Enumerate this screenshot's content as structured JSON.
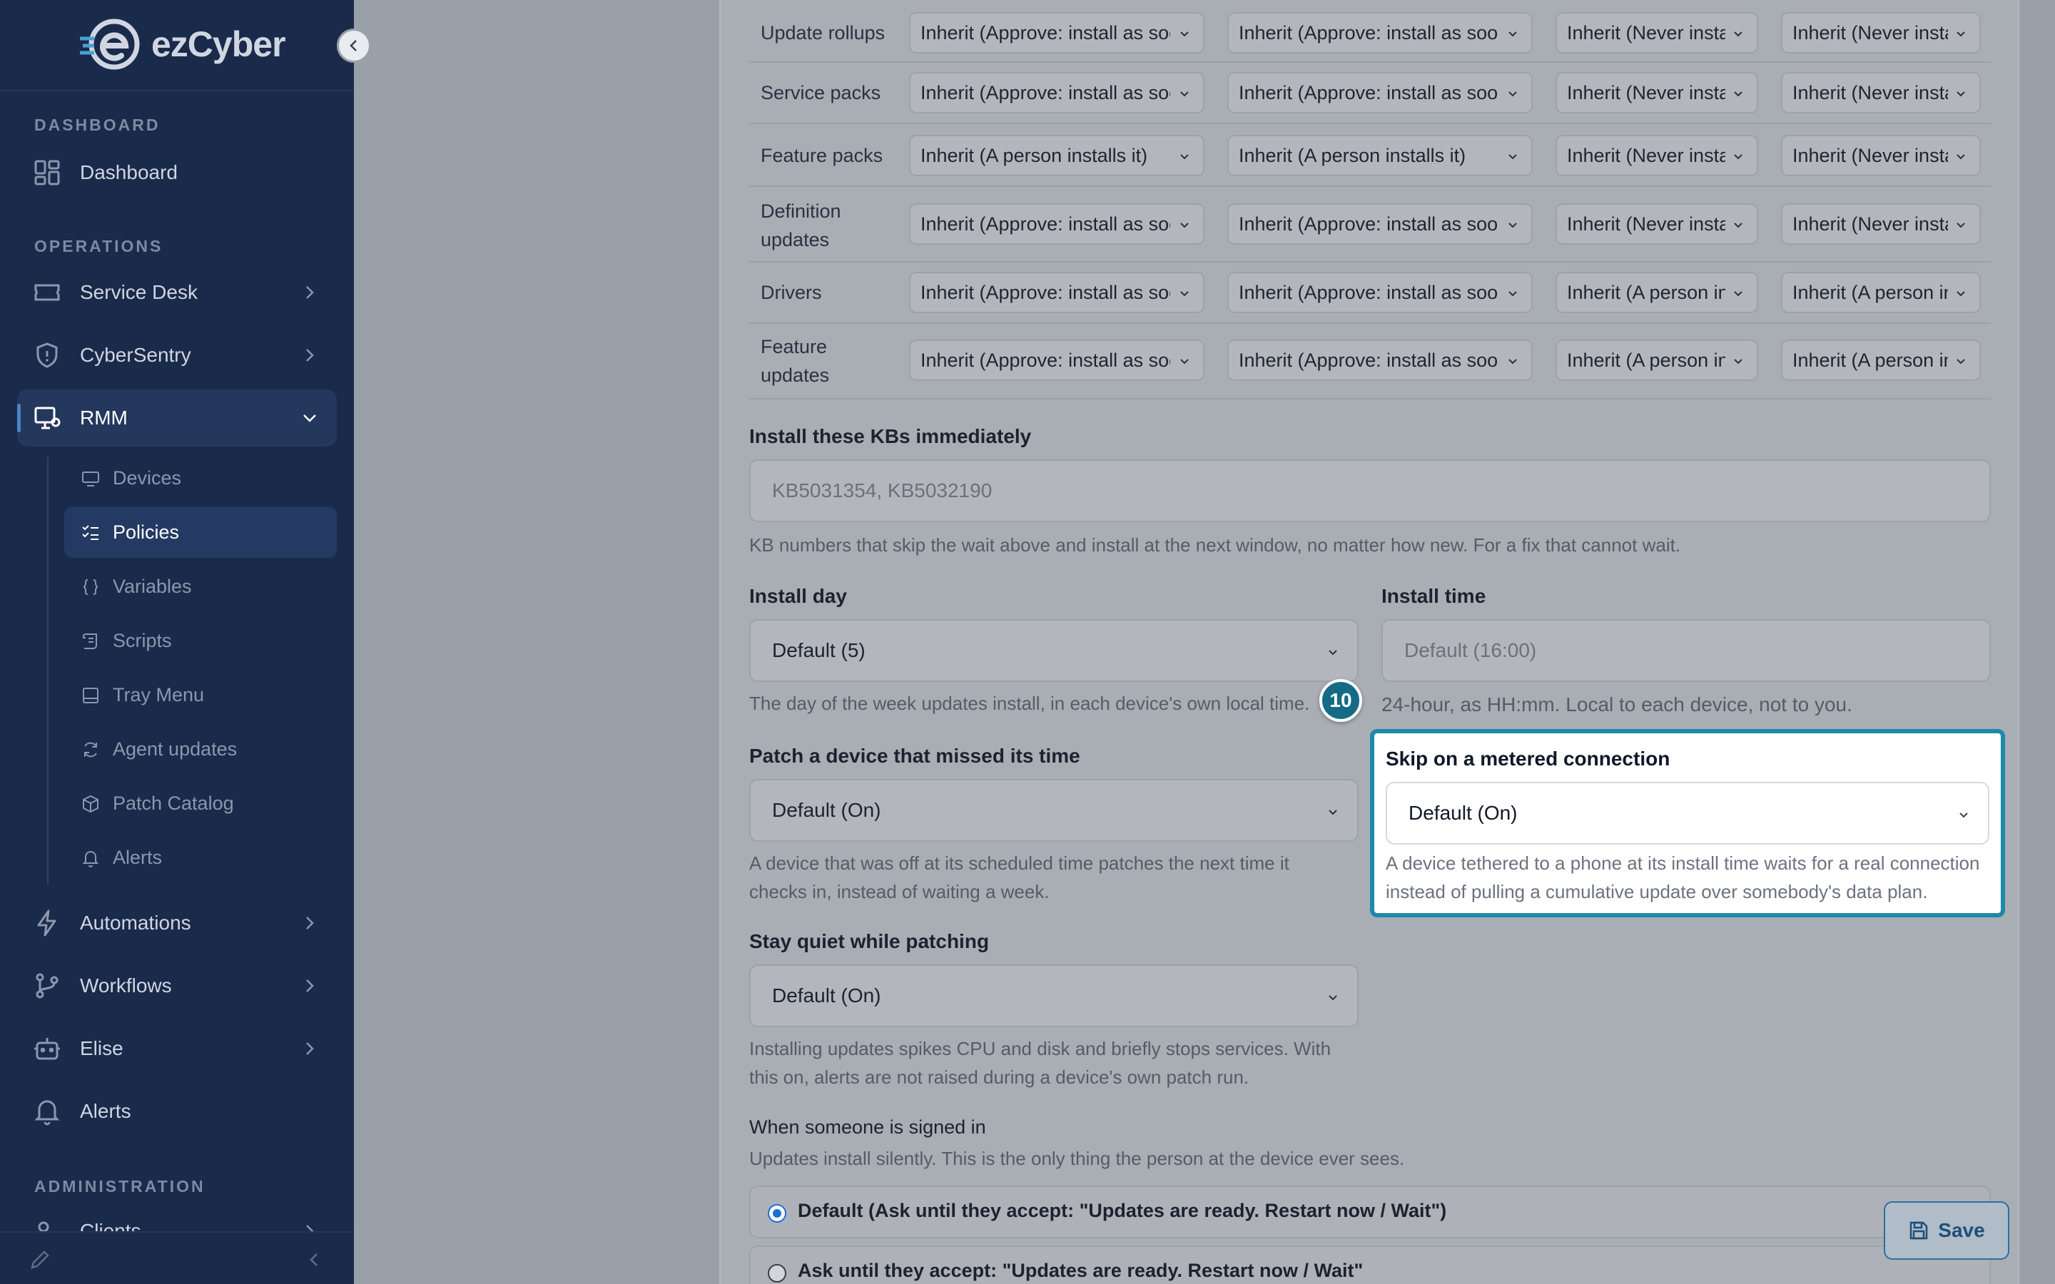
{
  "brand": {
    "name": "ezCyber"
  },
  "sidebar": {
    "sections": {
      "dashboard": "DASHBOARD",
      "operations": "OPERATIONS",
      "administration": "ADMINISTRATION"
    },
    "items": {
      "dashboard": "Dashboard",
      "service_desk": "Service Desk",
      "cybersentry": "CyberSentry",
      "rmm": "RMM",
      "automations": "Automations",
      "workflows": "Workflows",
      "elise": "Elise",
      "alerts": "Alerts",
      "clients": "Clients"
    },
    "rmm_sub": {
      "devices": "Devices",
      "policies": "Policies",
      "variables": "Variables",
      "scripts": "Scripts",
      "tray_menu": "Tray Menu",
      "agent_updates": "Agent updates",
      "patch_catalog": "Patch Catalog",
      "alerts": "Alerts"
    }
  },
  "update_rows": [
    {
      "label": "Update rollups",
      "c1": "Inherit (Approve: install as soon as released)",
      "c2": "Inherit (Approve: install as soon as released)",
      "c3": "Inherit (Never install)",
      "c4": "Inherit (Never install)"
    },
    {
      "label": "Service packs",
      "c1": "Inherit (Approve: install as soon as released)",
      "c2": "Inherit (Approve: install as soon as released)",
      "c3": "Inherit (Never install)",
      "c4": "Inherit (Never install)"
    },
    {
      "label": "Feature packs",
      "c1": "Inherit (A person installs it)",
      "c2": "Inherit (A person installs it)",
      "c3": "Inherit (Never install)",
      "c4": "Inherit (Never install)"
    },
    {
      "label_1": "Definition",
      "label_2": "updates",
      "c1": "Inherit (Approve: install as soon as released)",
      "c2": "Inherit (Approve: install as soon as released)",
      "c3": "Inherit (Never install)",
      "c4": "Inherit (Never install)"
    },
    {
      "label": "Drivers",
      "c1": "Inherit (Approve: install as soon as released)",
      "c2": "Inherit (Approve: install as soon as released)",
      "c3": "Inherit (A person installs it)",
      "c4": "Inherit (A person installs it)"
    },
    {
      "label_1": "Feature",
      "label_2": "updates",
      "c1": "Inherit (Approve: install as soon as released)",
      "c2": "Inherit (Approve: install as soon as released)",
      "c3": "Inherit (A person installs it)",
      "c4": "Inherit (A person installs it)"
    }
  ],
  "kbs": {
    "label": "Install these KBs immediately",
    "placeholder": "KB5031354, KB5032190",
    "help": "KB numbers that skip the wait above and install at the next window, no matter how new. For a fix that cannot wait."
  },
  "install_day": {
    "label": "Install day",
    "value": "Default (5)",
    "help": "The day of the week updates install, in each device's own local time."
  },
  "install_time": {
    "label": "Install time",
    "placeholder": "Default (16:00)",
    "help": "24-hour, as HH:mm. Local to each device, not to you."
  },
  "missed": {
    "label": "Patch a device that missed its time",
    "value": "Default (On)",
    "help_1": "A device that was off at its scheduled time patches the next time it",
    "help_2": "checks in, instead of waiting a week."
  },
  "metered": {
    "label": "Skip on a metered connection",
    "value": "Default (On)",
    "help_1": "A device tethered to a phone at its install time waits for a real connection",
    "help_2": "instead of pulling a cumulative update over somebody's data plan."
  },
  "quiet": {
    "label": "Stay quiet while patching",
    "value": "Default (On)",
    "help_1": "Installing updates spikes CPU and disk and briefly stops services. With",
    "help_2": "this on, alerts are not raised during a device's own patch run."
  },
  "signed_in": {
    "label": "When someone is signed in",
    "help": "Updates install silently. This is the only thing the person at the device ever sees.",
    "options": [
      "Default (Ask until they accept: \"Updates are ready. Restart now / Wait\")",
      "Ask until they accept: \"Updates are ready. Restart now / Wait\""
    ]
  },
  "step_badge": "10",
  "save_label": "Save"
}
